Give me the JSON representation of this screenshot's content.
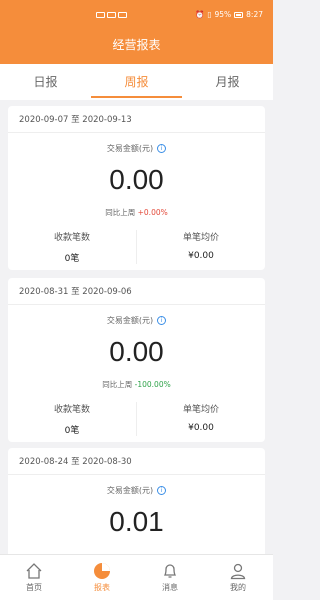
{
  "statusbar": {
    "battery": "95%",
    "time": "8:27"
  },
  "header": {
    "title": "经营报表"
  },
  "tabs": [
    {
      "label": "日报"
    },
    {
      "label": "周报"
    },
    {
      "label": "月报"
    }
  ],
  "cards": [
    {
      "range": "2020-09-07 至 2020-09-13",
      "amount_label": "交易金额(元)",
      "amount": "0.00",
      "compare_prefix": "同比上周",
      "compare_value": "+0.00%",
      "count_label": "收款笔数",
      "count_value": "0笔",
      "avg_label": "单笔均价",
      "avg_value": "¥0.00"
    },
    {
      "range": "2020-08-31 至 2020-09-06",
      "amount_label": "交易金额(元)",
      "amount": "0.00",
      "compare_prefix": "同比上周",
      "compare_value": "-100.00%",
      "count_label": "收款笔数",
      "count_value": "0笔",
      "avg_label": "单笔均价",
      "avg_value": "¥0.00"
    },
    {
      "range": "2020-08-24 至 2020-08-30",
      "amount_label": "交易金额(元)",
      "amount": "0.01"
    }
  ],
  "bottom_nav": [
    {
      "label": "首页",
      "icon": "home-icon"
    },
    {
      "label": "报表",
      "icon": "report-pie-icon"
    },
    {
      "label": "消息",
      "icon": "bell-icon"
    },
    {
      "label": "我的",
      "icon": "user-icon"
    }
  ],
  "colors": {
    "accent": "#f58d3b",
    "positive": "#e34a3a",
    "negative": "#2fa34a",
    "info": "#3a8ee6"
  }
}
